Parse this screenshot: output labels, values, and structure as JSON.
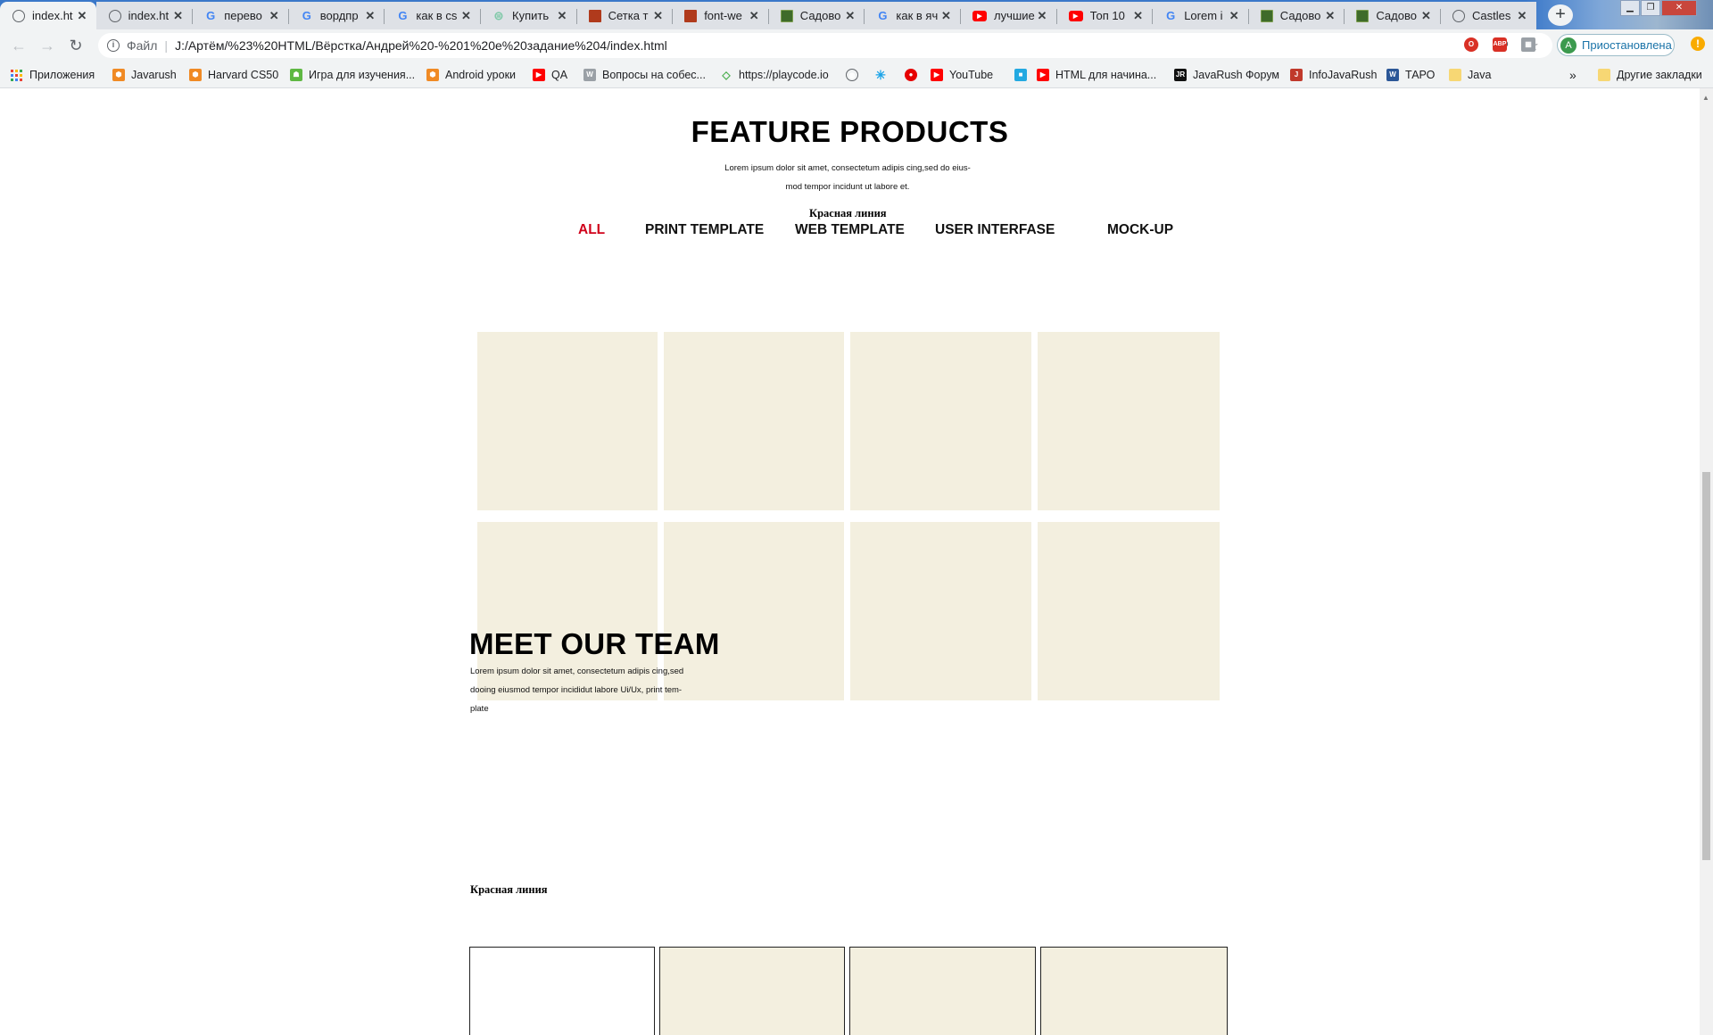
{
  "browser": {
    "tabs": [
      {
        "title": "index.ht",
        "icon": "globe-icon",
        "active": true
      },
      {
        "title": "index.ht",
        "icon": "globe-icon"
      },
      {
        "title": "перево",
        "icon": "google-icon"
      },
      {
        "title": "вордпр",
        "icon": "google-icon"
      },
      {
        "title": "как в cs",
        "icon": "google-icon"
      },
      {
        "title": "Купить",
        "icon": "shop-icon"
      },
      {
        "title": "Сетка т",
        "icon": "grid-icon"
      },
      {
        "title": "font-we",
        "icon": "grid-icon"
      },
      {
        "title": "Садово",
        "icon": "garden-icon"
      },
      {
        "title": "как в яч",
        "icon": "google-icon"
      },
      {
        "title": "лучшие",
        "icon": "youtube-icon"
      },
      {
        "title": "Топ 10",
        "icon": "youtube-icon"
      },
      {
        "title": "Lorem i",
        "icon": "google-icon"
      },
      {
        "title": "Садово",
        "icon": "garden-icon"
      },
      {
        "title": "Садово",
        "icon": "garden-icon"
      },
      {
        "title": "Castles",
        "icon": "globe-icon"
      }
    ],
    "new_tab_label": "+",
    "address": {
      "scheme_label": "Файл",
      "url": "J:/Артём/%23%20HTML/Вёрстка/Андрей%20-%201%20е%20задание%204/index.html"
    },
    "profile": {
      "initial": "A",
      "label": "Приостановлена"
    },
    "bookmarks": [
      {
        "label": "Приложения",
        "icon": "apps-icon"
      },
      {
        "label": "Javarush",
        "icon": "javarush-icon"
      },
      {
        "label": "Harvard CS50",
        "icon": "javarush-icon"
      },
      {
        "label": "Игра для изучения...",
        "icon": "android-icon"
      },
      {
        "label": "Android уроки",
        "icon": "javarush-icon"
      },
      {
        "label": "QA",
        "icon": "youtube-icon"
      },
      {
        "label": "Вопросы на собес...",
        "icon": "wordpress-icon"
      },
      {
        "label": "https://playcode.io",
        "icon": "playcode-icon"
      },
      {
        "label": "",
        "icon": "globe-icon"
      },
      {
        "label": "",
        "icon": "spark-icon"
      },
      {
        "label": "",
        "icon": "vodafone-icon"
      },
      {
        "label": "YouTube",
        "icon": "youtube-icon"
      },
      {
        "label": "",
        "icon": "video-icon"
      },
      {
        "label": "HTML для начина...",
        "icon": "youtube-icon"
      },
      {
        "label": "JavaRush Форум",
        "icon": "jr-icon"
      },
      {
        "label": "InfoJavaRush",
        "icon": "infojava-icon"
      },
      {
        "label": "ТАРО",
        "icon": "word-icon"
      },
      {
        "label": "Java",
        "icon": "folder-icon"
      }
    ],
    "overflow_label": "»",
    "other_bookmarks": "Другие закладки"
  },
  "page": {
    "feature": {
      "title": "FEATURE PRODUCTS",
      "desc_line1": "Lorem ipsum dolor sit amet, consectetum adipis cing,sed do eius-",
      "desc_line2": "mod tempor incidunt ut labore et.",
      "red_line": "Красная линия",
      "filters": [
        "ALL",
        "PRINT TEMPLATE",
        "WEB TEMPLATE",
        "USER INTERFASE",
        "MOCK-UP"
      ],
      "active_filter": "ALL",
      "accent_color": "#d0021b",
      "tile_color": "#f3efdf"
    },
    "team": {
      "title": "MEET OUR TEAM",
      "desc_line1": "Lorem ipsum dolor sit amet, consectetum adipis cing,sed",
      "desc_line2": "dooing eiusmod tempor incididut labore Ui/Ux, print tem-",
      "desc_line3": "plate",
      "red_line": "Красная линия"
    }
  }
}
